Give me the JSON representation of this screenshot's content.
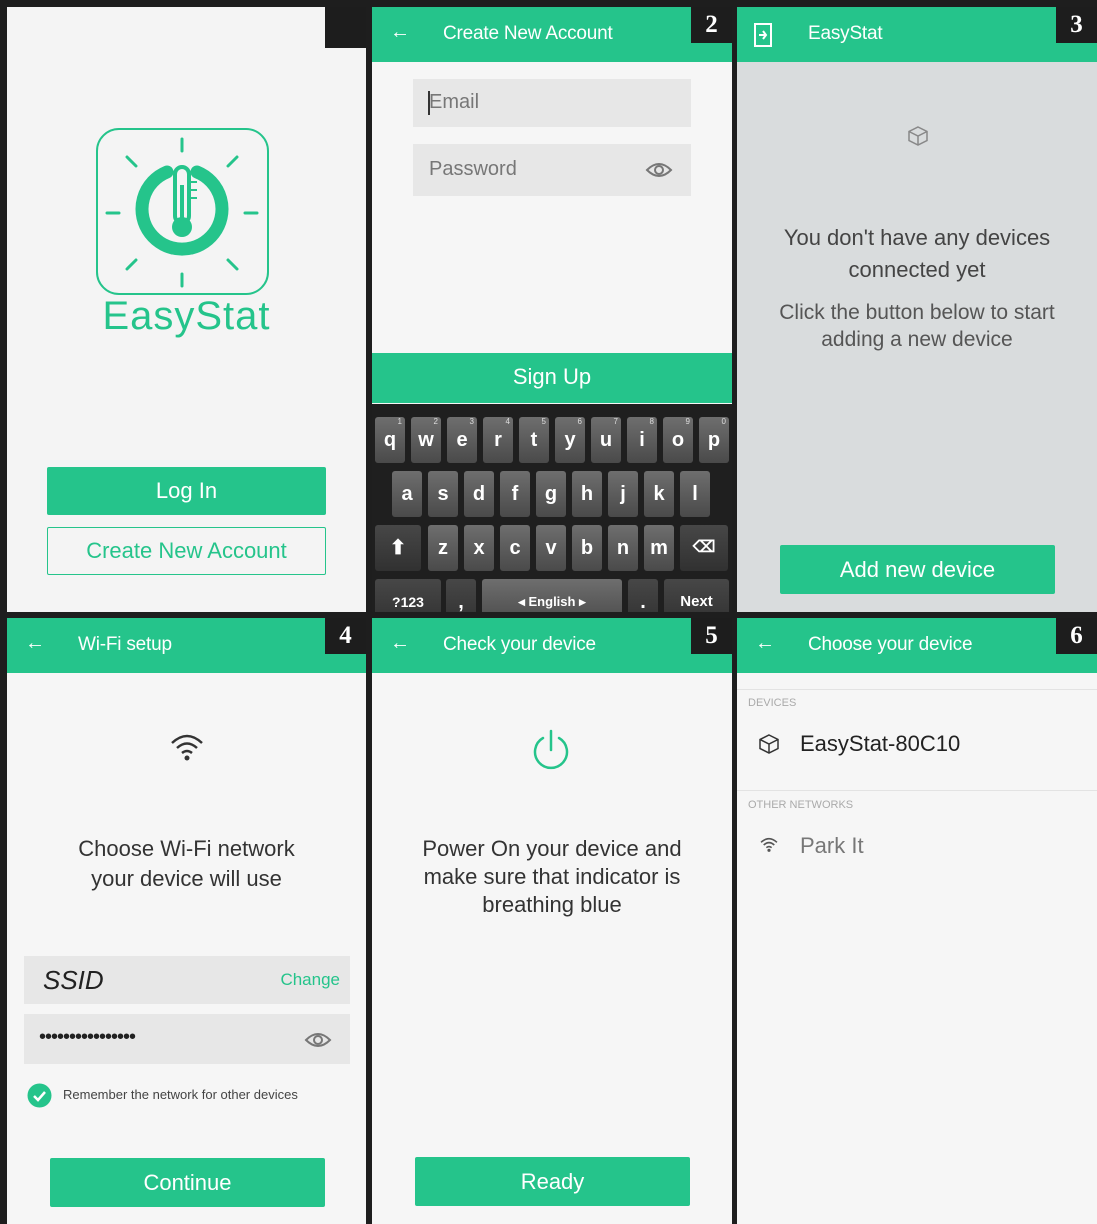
{
  "brand_color": "#25c48b",
  "panel1": {
    "app_name": "EasyStat",
    "login_button": "Log In",
    "create_account_button": "Create New Account"
  },
  "panel2": {
    "badge": "2",
    "back_icon": "arrow-left-icon",
    "title": "Create New Account",
    "email_placeholder": "Email",
    "password_placeholder": "Password",
    "signup_button": "Sign Up",
    "keyboard": {
      "row1": [
        {
          "k": "q",
          "n": "1"
        },
        {
          "k": "w",
          "n": "2"
        },
        {
          "k": "e",
          "n": "3"
        },
        {
          "k": "r",
          "n": "4"
        },
        {
          "k": "t",
          "n": "5"
        },
        {
          "k": "y",
          "n": "6"
        },
        {
          "k": "u",
          "n": "7"
        },
        {
          "k": "i",
          "n": "8"
        },
        {
          "k": "o",
          "n": "9"
        },
        {
          "k": "p",
          "n": "0"
        }
      ],
      "row2": [
        "a",
        "s",
        "d",
        "f",
        "g",
        "h",
        "j",
        "k",
        "l"
      ],
      "row3": [
        "z",
        "x",
        "c",
        "v",
        "b",
        "n",
        "m"
      ],
      "symbols_key": "?123",
      "comma_key": ",",
      "space_label": "◂ English ▸",
      "period_key": ".",
      "next_key": "Next"
    }
  },
  "panel3": {
    "badge": "3",
    "title": "EasyStat",
    "empty_line1": "You don't have any devices",
    "empty_line2": "connected yet",
    "hint_line1": "Click the button below to start",
    "hint_line2": "adding a new device",
    "add_button": "Add new device"
  },
  "panel4": {
    "badge": "4",
    "title": "Wi-Fi setup",
    "prompt_line1": "Choose Wi-Fi network",
    "prompt_line2": "your device will use",
    "ssid": "SSID",
    "change_link": "Change",
    "password_mask": "••••••••••••••••",
    "remember_label": "Remember the network for other devices",
    "continue_button": "Continue"
  },
  "panel5": {
    "badge": "5",
    "title": "Check your device",
    "line1": "Power On your device and",
    "line2": "make sure that indicator is",
    "line3": "breathing blue",
    "ready_button": "Ready"
  },
  "panel6": {
    "badge": "6",
    "title": "Choose your device",
    "devices_header": "DEVICES",
    "device_name": "EasyStat-80C10",
    "other_header": "OTHER NETWORKS",
    "network_name": "Park It"
  }
}
